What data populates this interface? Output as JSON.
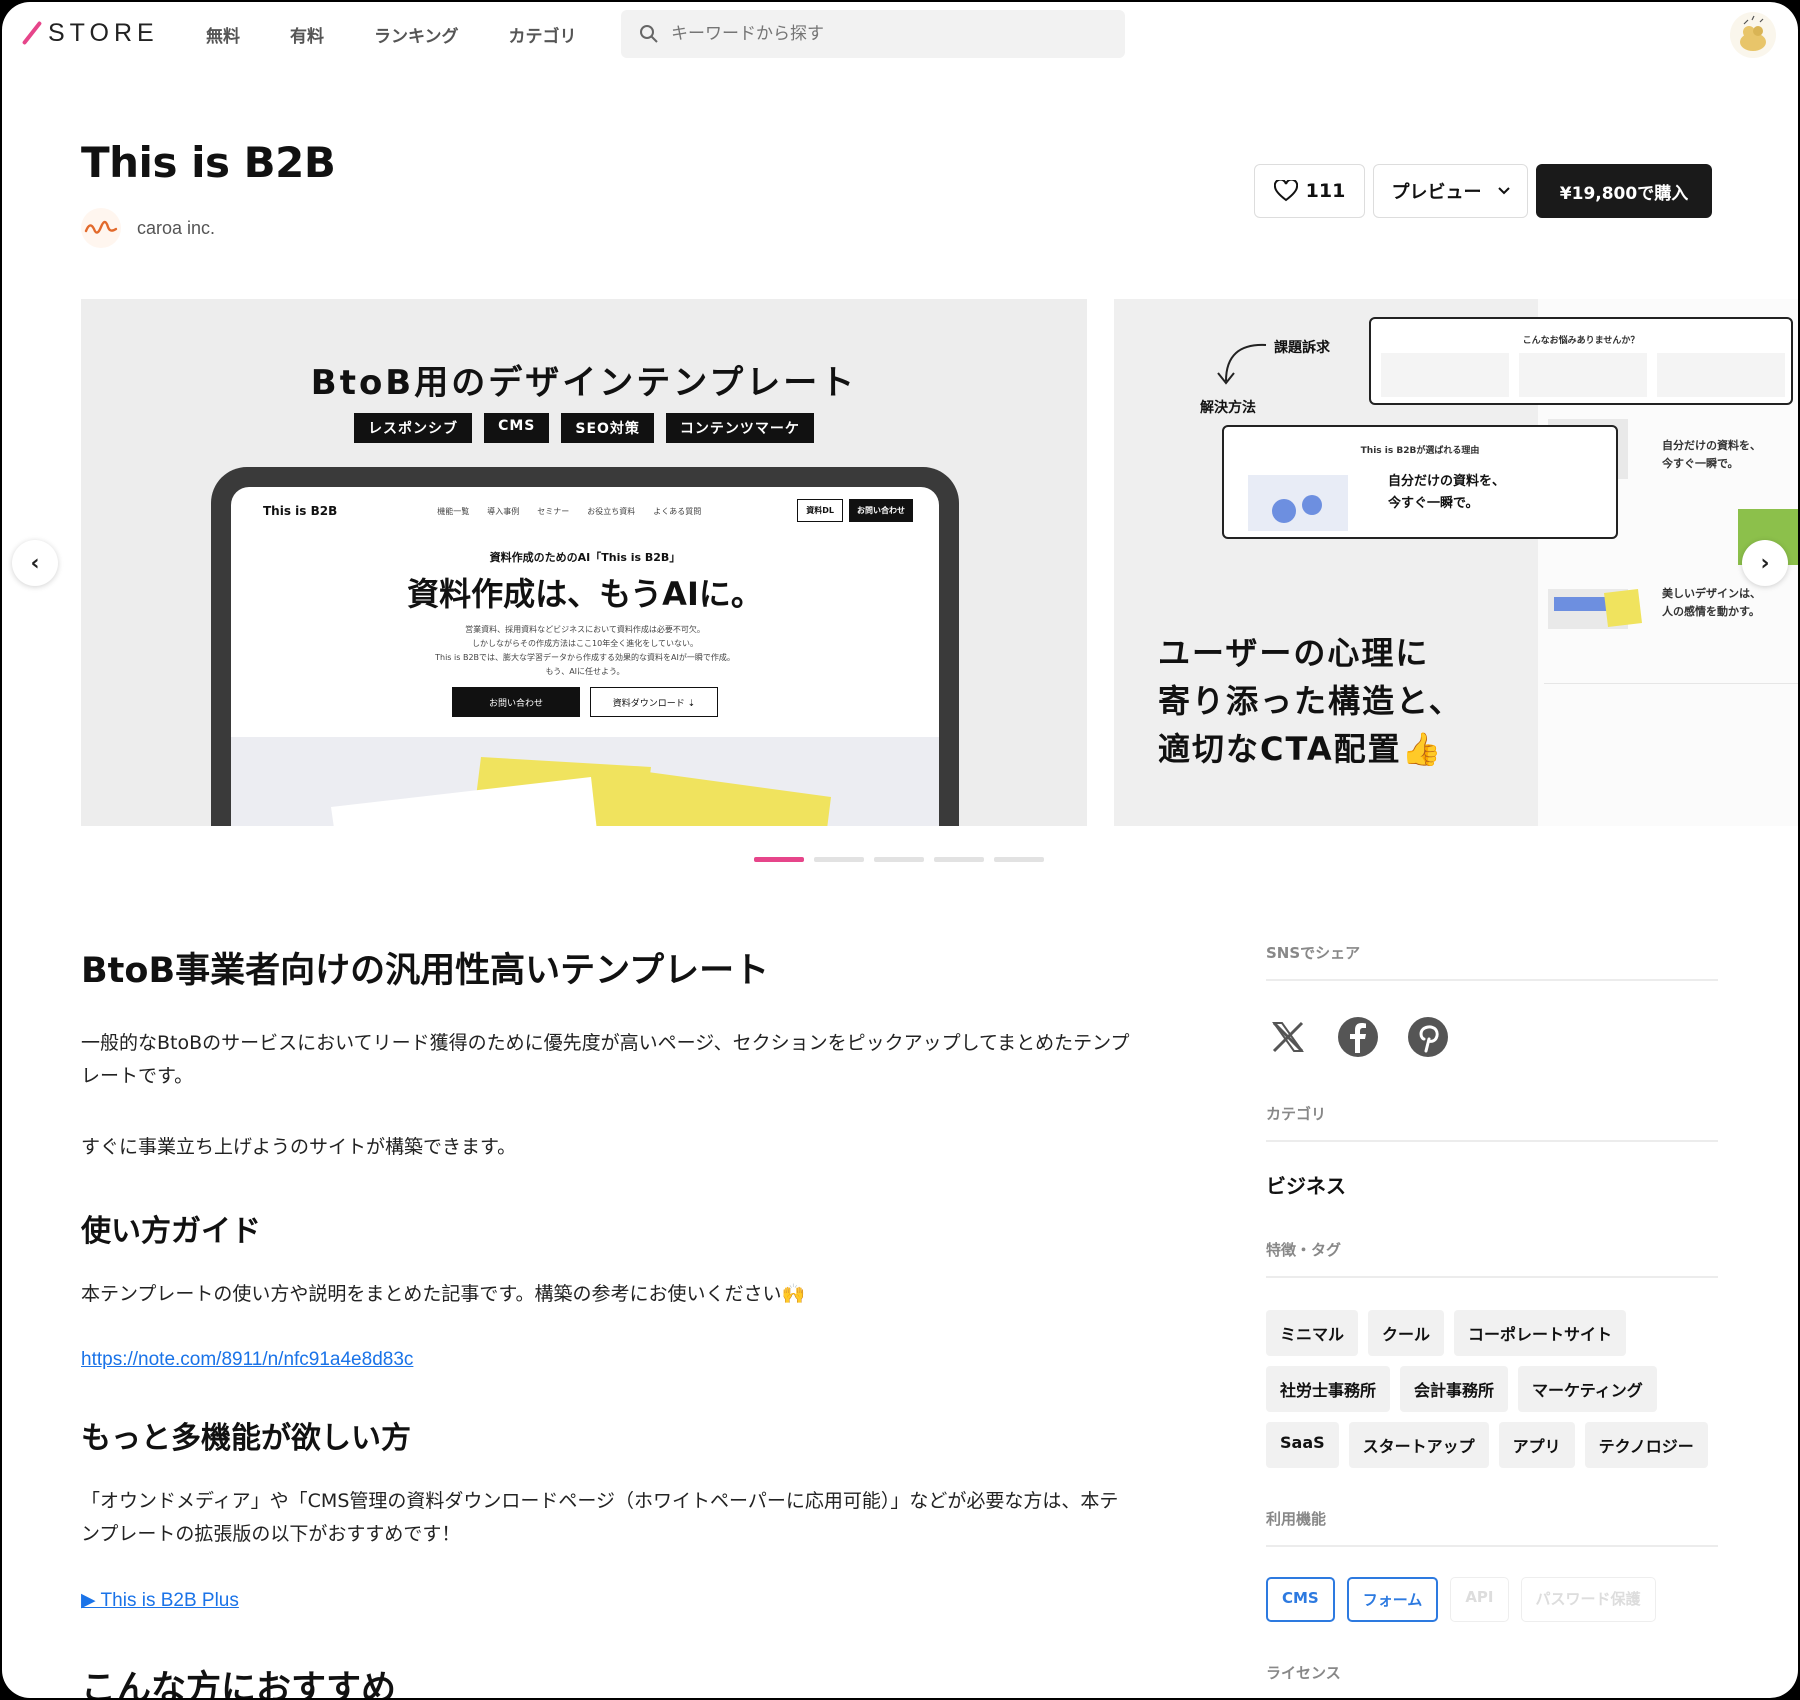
{
  "header": {
    "logo_text": "STORE",
    "nav": [
      "無料",
      "有料",
      "ランキング",
      "カテゴリ"
    ],
    "search_placeholder": "キーワードから探す"
  },
  "product": {
    "title": "This is B2B",
    "author": "caroa inc.",
    "likes": "111",
    "preview_label": "プレビュー",
    "buy_label": "¥19,800で購入"
  },
  "slides": {
    "slide1": {
      "heading": "BtoB用のデザインテンプレート",
      "tags": [
        "レスポンシブ",
        "CMS",
        "SEO対策",
        "コンテンツマーケ"
      ],
      "mock": {
        "logo": "This is B2B",
        "links": [
          "機能一覧",
          "導入事例",
          "セミナー",
          "お役立ち資料",
          "よくある質問"
        ],
        "btn_download": "資料DL",
        "btn_contact": "お問い合わせ",
        "kicker": "資料作成のためのAI「This is B2B」",
        "hero": "資料作成は、もうAIに。",
        "body": [
          "営業資料、採用資料などビジネスにおいて資料作成は必要不可欠。",
          "しかしながらその作成方法はここ10年全く進化をしていない。",
          "This is B2Bでは、膨大な学習データから作成する効果的な資料をAIが一瞬で作成。",
          "もう、AIに任せよう。"
        ],
        "cta1": "お問い合わせ",
        "cta2": "資料ダウンロード ⇣"
      }
    },
    "slide2": {
      "label_issue": "課題訴求",
      "label_solution": "解決方法",
      "card1_title": "こんなお悩みありませんか？",
      "card2_kicker": "This is B2Bが選ばれる理由",
      "card2_text": "自分だけの資料を、\n今すぐ一瞬で。",
      "side_title1": "自分だけの資料を、\n今すぐ一瞬で。",
      "side_title2": "美しいデザインは、\n人の感情を動かす。",
      "copy_lines": [
        "ユーザーの心理に",
        "寄り添った構造と、",
        "適切なCTA配置👍"
      ]
    },
    "dots_count": 5,
    "active_dot": 0
  },
  "content": {
    "h_main": "BtoB事業者向けの汎用性高いテンプレート",
    "intro_line1": "一般的なBtoBのサービスにおいてリード獲得のために優先度が高いページ、セクションをピックアップしてまとめたテンプ",
    "intro_line2": "レートです。",
    "intro_2": "すぐに事業立ち上げようのサイトが構築できます。",
    "h_guide": "使い方ガイド",
    "guide_text": "本テンプレートの使い方や説明をまとめた記事です。構築の参考にお使いください🙌",
    "guide_link": "https://note.com/8911/n/nfc91a4e8d83c",
    "h_more": "もっと多機能が欲しい方",
    "more_line1": "「オウンドメディア」や「CMS管理の資料ダウンロードページ（ホワイトペーパーに応用可能）」などが必要な方は、本テ",
    "more_line2": "ンプレートの拡張版の以下がおすすめです！",
    "more_link": "▶ This is B2B Plus",
    "h_recommend": "こんな方におすすめ"
  },
  "sidebar": {
    "sns_label": "SNSでシェア",
    "sns_icons": [
      "x-icon",
      "facebook-icon",
      "pinterest-icon"
    ],
    "category_label": "カテゴリ",
    "category_value": "ビジネス",
    "tags_label": "特徴・タグ",
    "tags": [
      "ミニマル",
      "クール",
      "コーポレートサイト",
      "社労士事務所",
      "会計事務所",
      "マーケティング",
      "SaaS",
      "スタートアップ",
      "アプリ",
      "テクノロジー"
    ],
    "features_label": "利用機能",
    "features": [
      {
        "label": "CMS",
        "enabled": true
      },
      {
        "label": "フォーム",
        "enabled": true
      },
      {
        "label": "API",
        "enabled": false
      },
      {
        "label": "パスワード保護",
        "enabled": false
      }
    ],
    "license_label": "ライセンス"
  },
  "colors": {
    "accent": "#e6458a",
    "link": "#1a73e8",
    "feature_blue": "#2d7ae0",
    "buy_button": "#1a1a1a"
  }
}
